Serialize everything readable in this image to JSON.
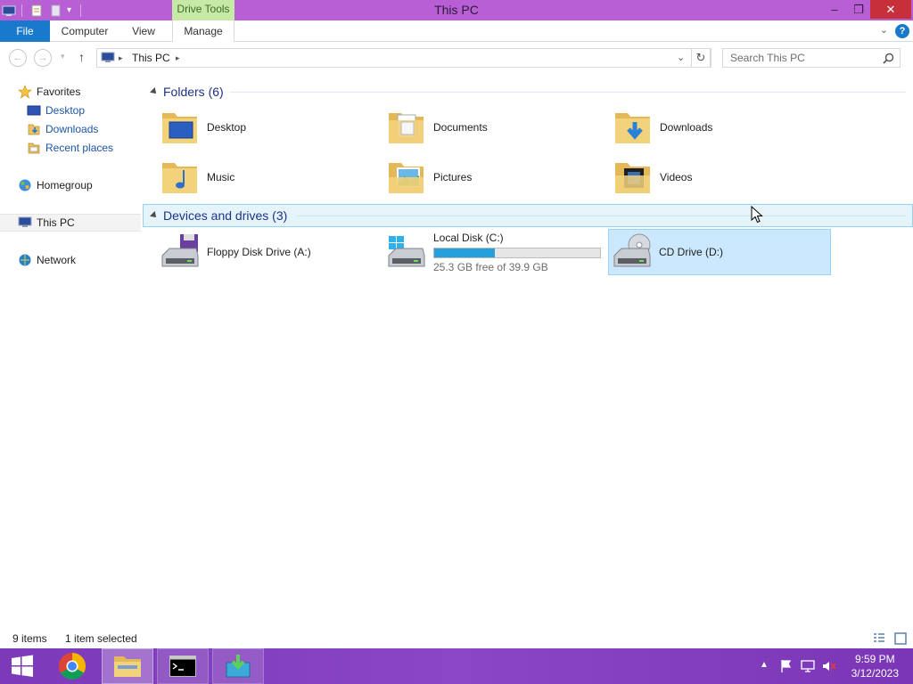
{
  "window": {
    "title": "This PC",
    "contextual_group": "Drive Tools",
    "controls": {
      "minimize": "–",
      "restore": "❐",
      "close": "✕"
    }
  },
  "ribbon": {
    "tabs": [
      {
        "label": "File"
      },
      {
        "label": "Computer"
      },
      {
        "label": "View"
      },
      {
        "label": "Manage"
      }
    ],
    "help": "?"
  },
  "address_bar": {
    "path": [
      "This PC"
    ],
    "search_placeholder": "Search This PC"
  },
  "nav_pane": {
    "favorites": {
      "label": "Favorites",
      "items": [
        {
          "label": "Desktop"
        },
        {
          "label": "Downloads"
        },
        {
          "label": "Recent places"
        }
      ]
    },
    "homegroup": "Homegroup",
    "this_pc": "This PC",
    "network": "Network"
  },
  "folders": {
    "title": "Folders (6)",
    "items": [
      {
        "label": "Desktop",
        "icon": "desktop-folder-icon"
      },
      {
        "label": "Documents",
        "icon": "documents-folder-icon"
      },
      {
        "label": "Downloads",
        "icon": "downloads-folder-icon"
      },
      {
        "label": "Music",
        "icon": "music-folder-icon"
      },
      {
        "label": "Pictures",
        "icon": "pictures-folder-icon"
      },
      {
        "label": "Videos",
        "icon": "videos-folder-icon"
      }
    ]
  },
  "devices": {
    "title": "Devices and drives (3)",
    "items": [
      {
        "label": "Floppy Disk Drive (A:)",
        "icon": "floppy-drive-icon"
      },
      {
        "label": "Local Disk (C:)",
        "icon": "local-disk-icon",
        "free_text": "25.3 GB free of 39.9 GB",
        "used_fraction": 0.366
      },
      {
        "label": "CD Drive (D:)",
        "icon": "cd-drive-icon",
        "selected": true
      }
    ]
  },
  "status": {
    "items_count": "9 items",
    "selection": "1 item selected"
  },
  "taskbar": {
    "clock_time": "9:59 PM",
    "clock_date": "3/12/2023",
    "apps": [
      "start-icon",
      "chrome-icon",
      "file-explorer-icon",
      "cmd-icon",
      "installer-icon"
    ]
  },
  "colors": {
    "titlebar": "#b95fd6",
    "accent": "#1979ca",
    "selection": "#cce8ff",
    "progress": "#26a0da",
    "taskbar": "#8a46c4"
  }
}
